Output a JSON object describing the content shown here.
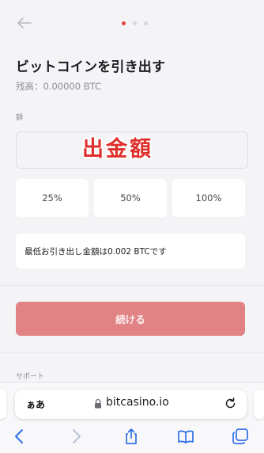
{
  "header": {
    "back_icon": "arrow-left-icon",
    "steps": [
      {
        "active": true
      },
      {
        "active": false
      },
      {
        "active": false
      }
    ]
  },
  "page": {
    "title": "ビットコインを引き出す",
    "balance": "残高：0.00000 BTC"
  },
  "amount": {
    "label": "額",
    "value": "",
    "overlay_text": "出金額"
  },
  "percent_buttons": [
    "25%",
    "50%",
    "100%"
  ],
  "notice": "最低お引き出し金額は0.002 BTCです",
  "actions": {
    "continue_label": "続ける"
  },
  "support_label": "サポート",
  "browser": {
    "text_size_label": "ぁあ",
    "url": "bitcasino.io",
    "icons": [
      "lock-icon",
      "reload-icon",
      "back-icon",
      "forward-icon",
      "share-icon",
      "bookmarks-icon",
      "tabs-icon"
    ]
  },
  "colors": {
    "accent": "#e1453f",
    "continue_button": "#e18385",
    "overlay_text": "#e0302c"
  }
}
